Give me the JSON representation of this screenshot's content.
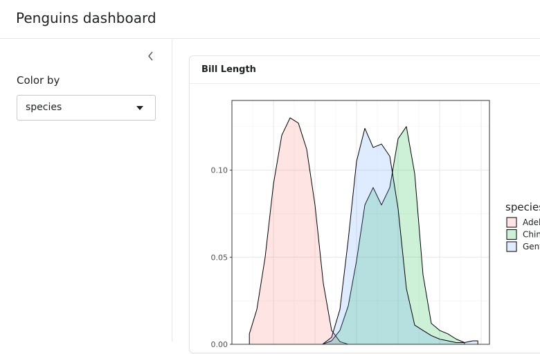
{
  "header": {
    "title": "Penguins dashboard"
  },
  "sidebar": {
    "collapse_icon": "chevron-left-icon",
    "control_label": "Color by",
    "select": {
      "value": "species",
      "icon": "caret-down-icon"
    }
  },
  "card": {
    "title": "Bill Length"
  },
  "chart_data": {
    "type": "area",
    "title": "",
    "xlabel": "",
    "ylabel": "",
    "ylim": [
      0,
      0.14
    ],
    "xlim": [
      30,
      61
    ],
    "yticks": [
      0.0,
      0.05,
      0.1
    ],
    "ytick_labels": [
      "0.00",
      "0.05",
      "0.10"
    ],
    "grid": true,
    "legend": {
      "title": "species",
      "placement": "right",
      "labels": [
        "Adelie",
        "Chinstrap",
        "Gentoo"
      ]
    },
    "series": [
      {
        "name": "Adelie",
        "fill": "#F8766D",
        "x": [
          32.1,
          33,
          34,
          35,
          36,
          37,
          38,
          39,
          40,
          41,
          42,
          43,
          44,
          45,
          46,
          47,
          48,
          49,
          50,
          51,
          52,
          53,
          54,
          55,
          56,
          57,
          58,
          59,
          60,
          61
        ],
        "y": [
          0.006,
          0.02,
          0.05,
          0.092,
          0.12,
          0.13,
          0.127,
          0.112,
          0.08,
          0.035,
          0.008,
          0.0015,
          0,
          0,
          0,
          0,
          0,
          0,
          0,
          0,
          0,
          0,
          0,
          0,
          0,
          0,
          0,
          0,
          0,
          0
        ]
      },
      {
        "name": "Chinstrap",
        "fill": "#00BA38",
        "x": [
          40.9,
          42,
          43,
          44,
          45,
          46,
          47,
          48,
          49,
          50,
          51,
          52,
          53,
          54,
          55,
          56,
          57,
          58
        ],
        "y": [
          0,
          0.002,
          0.008,
          0.022,
          0.048,
          0.08,
          0.09,
          0.08,
          0.09,
          0.118,
          0.125,
          0.098,
          0.04,
          0.012,
          0.008,
          0.006,
          0.003,
          0.001
        ]
      },
      {
        "name": "Gentoo",
        "fill": "#619CFF",
        "x": [
          40.9,
          42,
          43,
          44,
          45,
          46,
          47,
          48,
          49,
          50,
          51,
          52,
          53,
          54,
          55,
          56,
          57,
          58,
          59,
          59.6
        ],
        "y": [
          0,
          0.004,
          0.02,
          0.06,
          0.105,
          0.124,
          0.113,
          0.115,
          0.108,
          0.078,
          0.032,
          0.011,
          0.008,
          0.005,
          0.003,
          0.002,
          0.001,
          0.001,
          0.002,
          0.002
        ]
      }
    ]
  }
}
